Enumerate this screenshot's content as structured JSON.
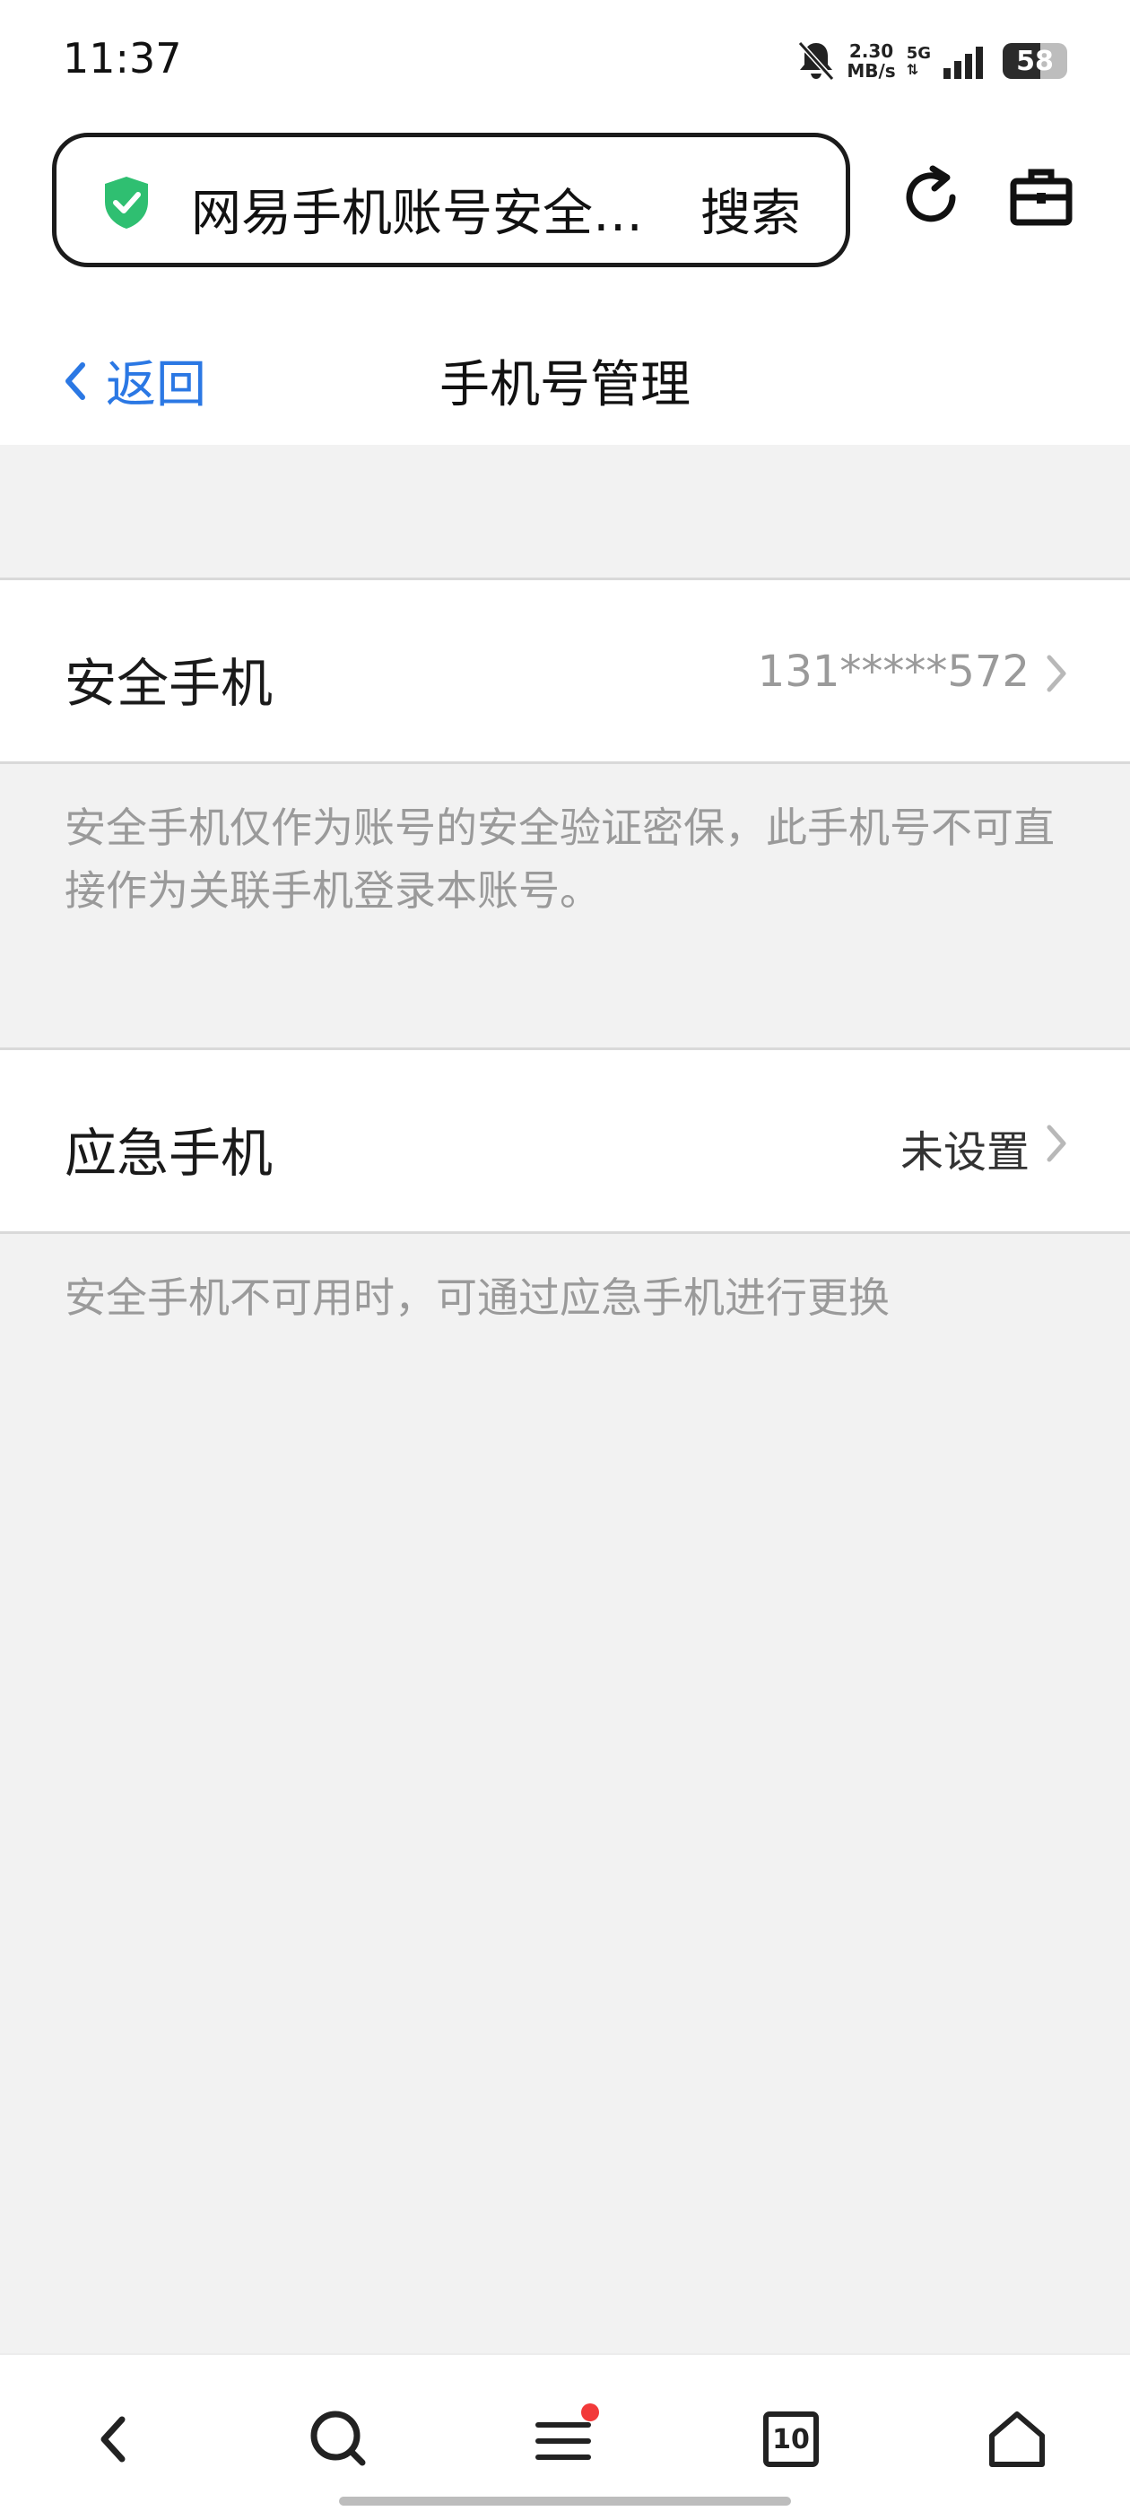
{
  "status_bar": {
    "time": "11:37",
    "net_speed_value": "2.30",
    "net_speed_unit": "MB/s",
    "network": "5G",
    "battery_level": "58",
    "battery_fraction": 0.58
  },
  "browser": {
    "url_title": "网易手机账号安全中心",
    "search_label": "搜索",
    "shield_color": "#2fbf71",
    "icons": [
      "shield-check-icon",
      "refresh-icon",
      "toolbox-icon"
    ]
  },
  "header": {
    "back_label": "返回",
    "title": "手机号管理",
    "accent_color": "#2b78e4"
  },
  "security_phone": {
    "label": "安全手机",
    "value": "131*****572",
    "note": "安全手机仅作为账号的安全验证密保，此手机号不可直接作为关联手机登录本账号。"
  },
  "emergency_phone": {
    "label": "应急手机",
    "value": "未设置",
    "note": "安全手机不可用时，可通过应急手机进行更换"
  },
  "bottom_nav": {
    "tabs_count": "10",
    "icons": [
      "back-icon",
      "search-icon",
      "menu-icon",
      "tabs-icon",
      "home-icon"
    ],
    "notification_dot_color": "#f23a3a"
  }
}
